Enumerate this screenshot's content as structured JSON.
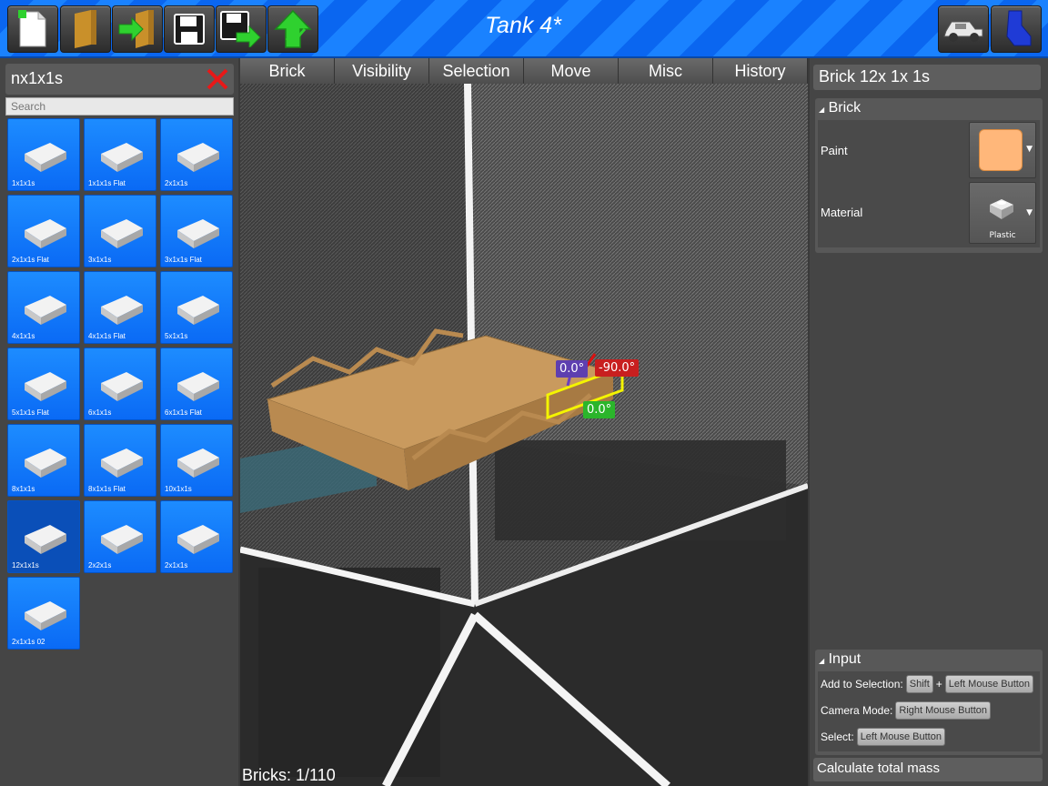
{
  "window": {
    "title": "Tank 4*"
  },
  "toolbar": {
    "buttons": [
      {
        "name": "new-file",
        "icon": "new-document-icon"
      },
      {
        "name": "open-file",
        "icon": "folder-icon"
      },
      {
        "name": "import",
        "icon": "import-icon"
      },
      {
        "name": "save",
        "icon": "save-icon"
      },
      {
        "name": "save-as",
        "icon": "save-as-icon"
      },
      {
        "name": "upload",
        "icon": "upload-icon"
      }
    ],
    "right_buttons": [
      {
        "name": "vehicle",
        "icon": "vehicle-icon"
      },
      {
        "name": "character",
        "icon": "character-icon"
      }
    ]
  },
  "brick_library": {
    "category": "nx1x1s",
    "search_placeholder": "Search",
    "items": [
      {
        "label": "1x1x1s"
      },
      {
        "label": "1x1x1s Flat"
      },
      {
        "label": "2x1x1s"
      },
      {
        "label": "2x1x1s Flat"
      },
      {
        "label": "3x1x1s"
      },
      {
        "label": "3x1x1s Flat"
      },
      {
        "label": "4x1x1s"
      },
      {
        "label": "4x1x1s Flat"
      },
      {
        "label": "5x1x1s"
      },
      {
        "label": "5x1x1s Flat"
      },
      {
        "label": "6x1x1s"
      },
      {
        "label": "6x1x1s Flat"
      },
      {
        "label": "8x1x1s"
      },
      {
        "label": "8x1x1s Flat"
      },
      {
        "label": "10x1x1s"
      },
      {
        "label": "12x1x1s"
      },
      {
        "label": "2x2x1s"
      },
      {
        "label": "2x1x1s"
      },
      {
        "label": "2x1x1s 02"
      }
    ],
    "selected_index": 15
  },
  "tabs": [
    "Brick",
    "Visibility",
    "Selection",
    "Move",
    "Misc",
    "History"
  ],
  "viewport": {
    "rotation_labels": {
      "x": "0.0°",
      "y": "-90.0°",
      "z": "0.0°"
    },
    "status": "Bricks: 1/110"
  },
  "properties": {
    "title": "Brick 12x 1x 1s",
    "brick_section": "Brick",
    "paint_label": "Paint",
    "paint_color": "#ffb77a",
    "material_label": "Material",
    "material_value": "Plastic",
    "input_section": "Input",
    "add_selection_label": "Add to Selection:",
    "shift_key": "Shift",
    "plus": "+",
    "left_mouse": "Left Mouse Button",
    "camera_mode_label": "Camera Mode:",
    "right_mouse": "Right Mouse Button",
    "select_label": "Select:",
    "select_mouse": "Left Mouse Button",
    "mass_button": "Calculate total mass"
  }
}
